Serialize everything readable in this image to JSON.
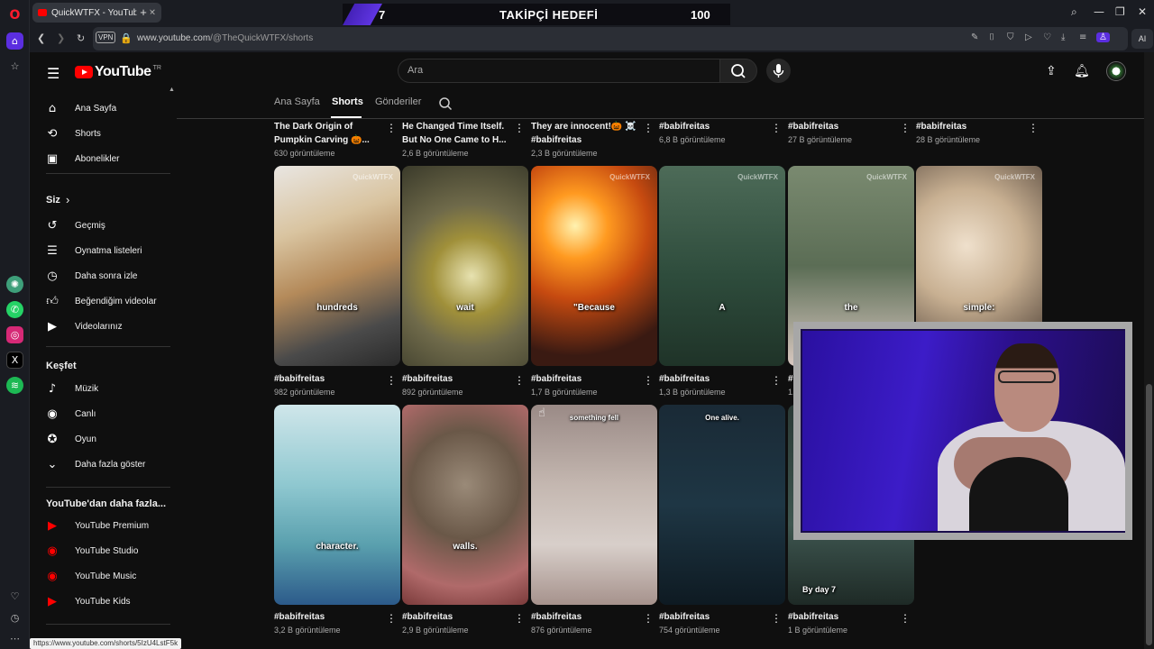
{
  "browser": {
    "tab_title": "QuickWTFX - YouTube",
    "url_host": "www.youtube.com",
    "url_path": "/@TheQuickWTFX/shorts",
    "vpn_label": "VPN",
    "ai_label": "AI",
    "status_url": "https://www.youtube.com/shorts/5IzU4LstF5k"
  },
  "stream_overlay": {
    "goal_current": "7",
    "goal_title": "TAKİPÇİ HEDEFİ",
    "goal_target": "100"
  },
  "youtube": {
    "logo_text": "YouTube",
    "logo_region": "TR",
    "search_placeholder": "Ara"
  },
  "sidebar": {
    "main": [
      {
        "label": "Ana Sayfa",
        "icon": "home-icon"
      },
      {
        "label": "Shorts",
        "icon": "shorts-icon"
      },
      {
        "label": "Abonelikler",
        "icon": "subscriptions-icon"
      }
    ],
    "you_title": "Siz",
    "you": [
      {
        "label": "Geçmiş",
        "icon": "history-icon"
      },
      {
        "label": "Oynatma listeleri",
        "icon": "playlists-icon"
      },
      {
        "label": "Daha sonra izle",
        "icon": "watch-later-icon"
      },
      {
        "label": "Beğendiğim videolar",
        "icon": "like-icon"
      },
      {
        "label": "Videolarınız",
        "icon": "your-videos-icon"
      }
    ],
    "explore_title": "Keşfet",
    "explore": [
      {
        "label": "Müzik",
        "icon": "music-icon"
      },
      {
        "label": "Canlı",
        "icon": "live-icon"
      },
      {
        "label": "Oyun",
        "icon": "gaming-icon"
      },
      {
        "label": "Daha fazla göster",
        "icon": "chevron-down-icon"
      }
    ],
    "more_title": "YouTube'dan daha fazla...",
    "more": [
      {
        "label": "YouTube Premium",
        "icon": "youtube-premium-icon"
      },
      {
        "label": "YouTube Studio",
        "icon": "youtube-studio-icon"
      },
      {
        "label": "YouTube Music",
        "icon": "youtube-music-icon"
      },
      {
        "label": "YouTube Kids",
        "icon": "youtube-kids-icon"
      }
    ]
  },
  "channel_tabs": [
    "Ana Sayfa",
    "Shorts",
    "Gönderiler"
  ],
  "shorts_row0": [
    {
      "title": "The Dark Origin of Pumpkin Carving 🎃...",
      "views": "630 görüntüleme"
    },
    {
      "title": "He Changed Time Itself. But No One Came to H...",
      "views": "2,6 B görüntüleme"
    },
    {
      "title": "They are innocent!🎃 ☠️ #babifreitas",
      "views": "2,3 B görüntüleme"
    },
    {
      "title": "#babifreitas",
      "views": "6,8 B görüntüleme"
    },
    {
      "title": "#babifreitas",
      "views": "27 B görüntüleme"
    },
    {
      "title": "#babifreitas",
      "views": "28 B görüntüleme"
    }
  ],
  "shorts_row1": [
    {
      "caption": "hundreds",
      "title": "#babifreitas",
      "views": "982 görüntüleme",
      "watermark": "QuickWTFX"
    },
    {
      "caption": "wait",
      "title": "#babifreitas",
      "views": "892 görüntüleme",
      "watermark": ""
    },
    {
      "caption": "\"Because",
      "title": "#babifreitas",
      "views": "1,7 B görüntüleme",
      "watermark": "QuickWTFX"
    },
    {
      "caption": "A",
      "title": "#babifreitas",
      "views": "1,3 B görüntüleme",
      "watermark": "QuickWTFX"
    },
    {
      "caption": "the",
      "title": "#ba",
      "views": "1,",
      "watermark": "QuickWTFX"
    },
    {
      "caption": "simple:",
      "title": "",
      "views": "",
      "watermark": "QuickWTFX"
    }
  ],
  "shorts_row2": [
    {
      "caption": "character.",
      "title": "#babifreitas",
      "views": "3,2 B görüntüleme",
      "top_text": ""
    },
    {
      "caption": "walls.",
      "title": "#babifreitas",
      "views": "2,9 B görüntüleme",
      "top_text": ""
    },
    {
      "caption": "",
      "title": "#babifreitas",
      "views": "876 görüntüleme",
      "top_text": "something fell"
    },
    {
      "caption": "",
      "title": "#babifreitas",
      "views": "754 görüntüleme",
      "top_text": "One alive."
    },
    {
      "caption": "By day 7",
      "title": "#babifreitas",
      "views": "1 B görüntüleme",
      "top_text": ""
    }
  ],
  "colors": {
    "accent": "#ff0000",
    "background": "#0f0f0f",
    "goal_bar": "#5b30e6"
  }
}
